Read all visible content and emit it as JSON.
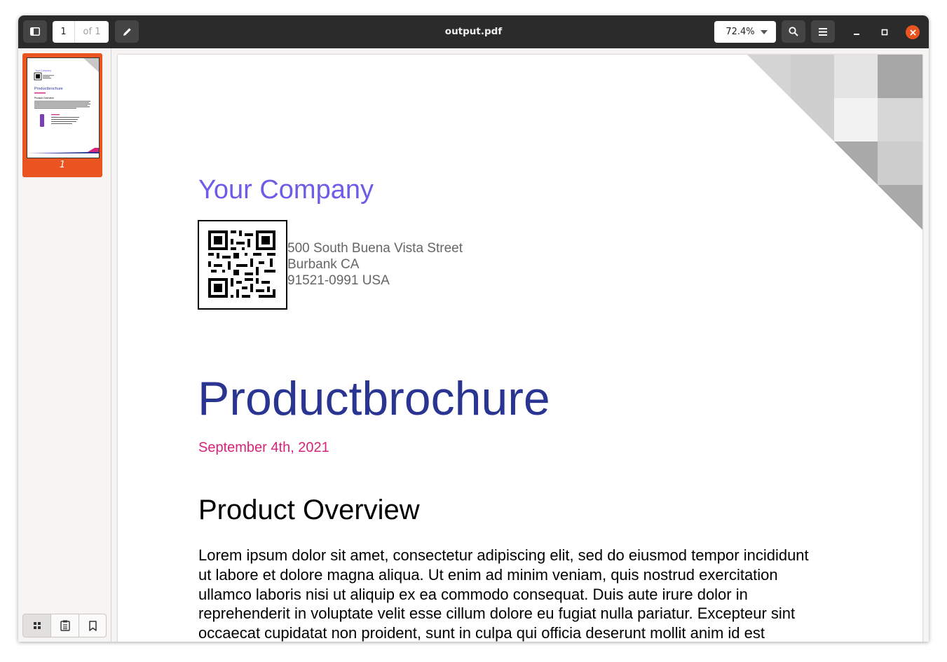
{
  "app": {
    "title": "output.pdf",
    "page_current": "1",
    "page_total": "of 1",
    "zoom": "72.4%"
  },
  "sidebar": {
    "thumbnail_label": "1",
    "tabs": [
      "thumbnails-icon",
      "outline-icon",
      "bookmark-icon"
    ]
  },
  "document": {
    "company": "Your Company",
    "address": {
      "line1": "500 South Buena Vista Street",
      "line2": "Burbank CA",
      "line3": "91521-0991 USA"
    },
    "title": "Productbrochure",
    "date": "September 4th, 2021",
    "section_heading": "Product Overview",
    "body_lines": [
      "Lorem ipsum dolor sit amet, consectetur adipiscing elit, sed do eiusmod tempor incididunt",
      "ut labore et dolore magna aliqua. Ut enim ad minim veniam, quis nostrud exercitation",
      "ullamco laboris nisi ut aliquip ex ea commodo consequat. Duis aute irure dolor in",
      "reprehenderit in voluptate velit esse cillum dolore eu fugiat nulla pariatur. Excepteur sint",
      "occaecat cupidatat non proident, sunt in culpa qui officia deserunt mollit anim id est"
    ]
  },
  "colors": {
    "accent": "#e95420",
    "company": "#6c5ce7",
    "title": "#2a3592",
    "date": "#d8237a",
    "header": "#2b2b2b"
  }
}
